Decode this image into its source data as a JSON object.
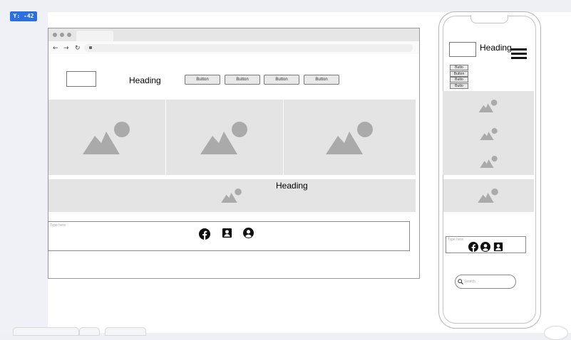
{
  "editor": {
    "coordinate_readout": "Y: -42"
  },
  "desktop": {
    "header": {
      "heading": "Heading",
      "buttons": [
        "Button",
        "Button",
        "Button",
        "Button"
      ]
    },
    "banner": {
      "heading": "Heading"
    },
    "footer": {
      "textarea_placeholder": "Type here"
    }
  },
  "mobile": {
    "header": {
      "heading": "Heading",
      "buttons": [
        "Butto",
        "Button",
        "Butto",
        "Butto"
      ]
    },
    "footer": {
      "textarea_placeholder": "Type here"
    },
    "search": {
      "placeholder": "Search"
    }
  },
  "colors": {
    "placeholder_image_bg": "#e4e4e4",
    "placeholder_glyph": "#aaaaaa",
    "coordinate_badge": "#2b6fe0"
  }
}
